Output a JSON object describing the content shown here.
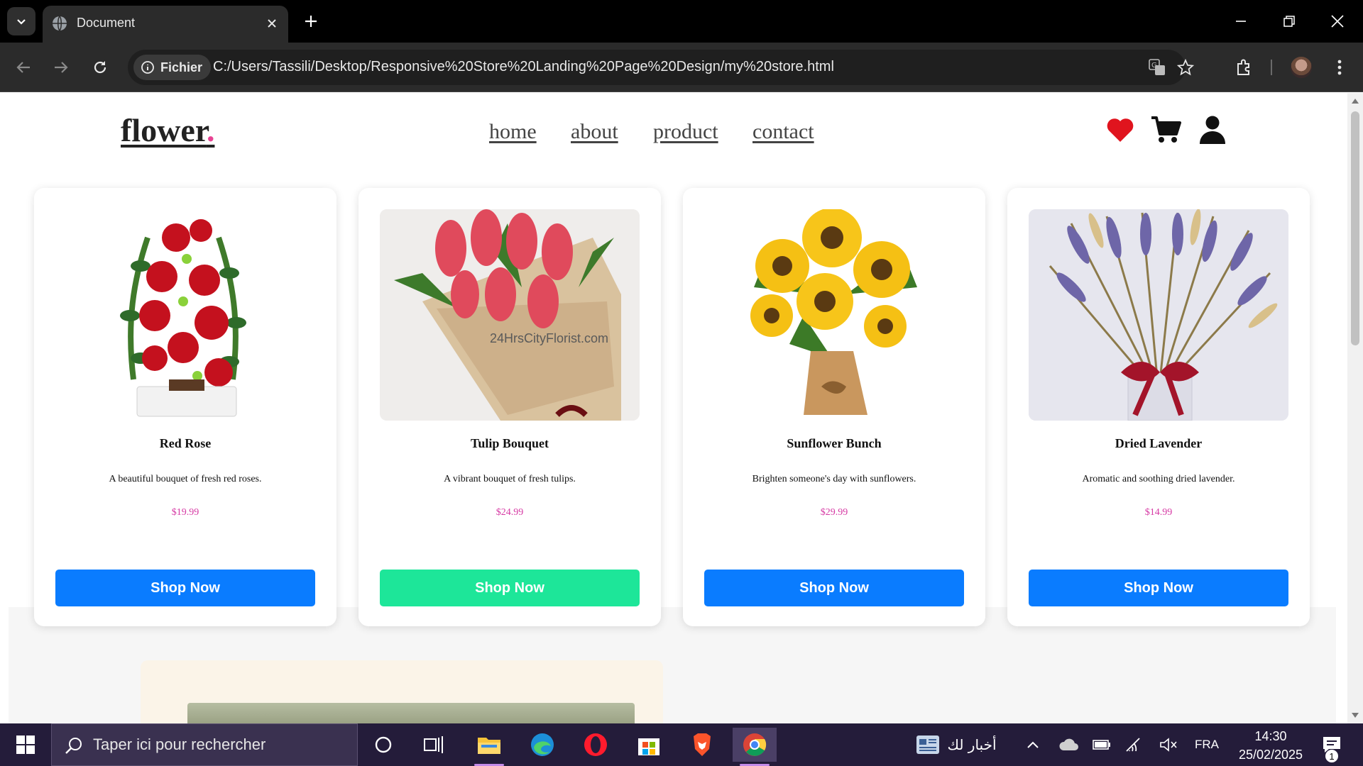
{
  "browser": {
    "tab_title": "Document",
    "chip_label": "Fichier",
    "url": "C:/Users/Tassili/Desktop/Responsive%20Store%20Landing%20Page%20Design/my%20store.html"
  },
  "site": {
    "logo": "flower",
    "logo_dot": ".",
    "nav": [
      "home",
      "about",
      "product",
      "contact"
    ]
  },
  "products": [
    {
      "name": "Red Rose",
      "description": "A beautiful bouquet of fresh red roses.",
      "price": "$19.99",
      "button": "Shop Now",
      "button_color": "#0a7cff"
    },
    {
      "name": "Tulip Bouquet",
      "description": "A vibrant bouquet of fresh tulips.",
      "price": "$24.99",
      "button": "Shop Now",
      "button_color": "#1de699",
      "image_watermark": "24HrsCityFlorist.com"
    },
    {
      "name": "Sunflower Bunch",
      "description": "Brighten someone's day with sunflowers.",
      "price": "$29.99",
      "button": "Shop Now",
      "button_color": "#0a7cff"
    },
    {
      "name": "Dried Lavender",
      "description": "Aromatic and soothing dried lavender.",
      "price": "$14.99",
      "button": "Shop Now",
      "button_color": "#0a7cff"
    }
  ],
  "taskbar": {
    "search_placeholder": "Taper ici pour rechercher",
    "news_label": "أخبار لك",
    "language": "FRA",
    "time": "14:30",
    "date": "25/02/2025",
    "notification_count": "1"
  },
  "colors": {
    "accent_pink": "#e84393",
    "price_color": "#d63aa4",
    "heart": "#e0141e"
  }
}
